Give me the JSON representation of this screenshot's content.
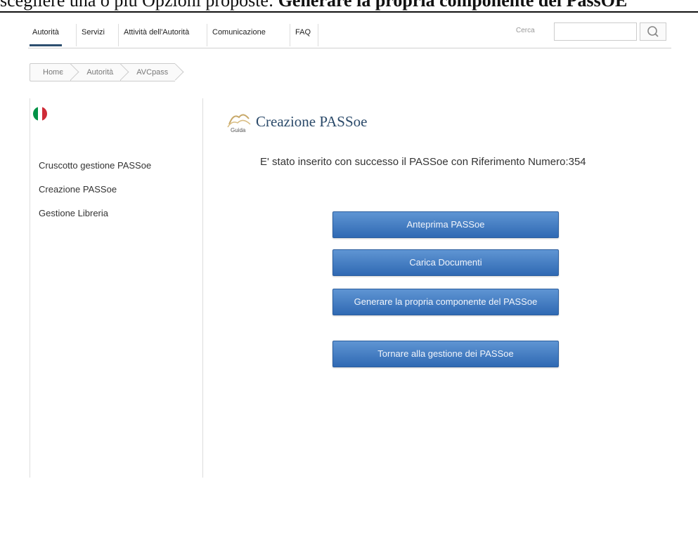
{
  "caption": {
    "prefix": "scegliere una o più Opzioni proposte:",
    "bold": "Generare la propria componente del PassOE"
  },
  "nav": {
    "items": [
      {
        "label": "Autorità"
      },
      {
        "label": "Servizi"
      },
      {
        "label": "Attività dell'Autorità"
      },
      {
        "label": "Comunicazione"
      },
      {
        "label": "FAQ"
      }
    ],
    "search_label": "Cerca",
    "search_value": ""
  },
  "breadcrumb": {
    "items": [
      {
        "label": "Home"
      },
      {
        "label": "Autorità"
      },
      {
        "label": "AVCpass"
      }
    ]
  },
  "sidebar": {
    "links": [
      {
        "label": "Cruscotto gestione PASSoe"
      },
      {
        "label": "Creazione PASSoe"
      },
      {
        "label": "Gestione Libreria"
      }
    ]
  },
  "main": {
    "title": "Creazione PASSoe",
    "icon_text": "Guida",
    "message": "E' stato inserito con successo il PASSoe con Riferimento Numero:354",
    "buttons": [
      {
        "label": "Anteprima PASSoe"
      },
      {
        "label": "Carica Documenti"
      },
      {
        "label": "Generare la propria componente del PASSoe"
      },
      {
        "label": "Tornare alla gestione dei PASSoe"
      }
    ]
  },
  "colors": {
    "button": "#3d77c0",
    "title": "#2b4a6a",
    "flag_green": "#009246",
    "flag_white": "#ffffff",
    "flag_red": "#ce2b37"
  }
}
